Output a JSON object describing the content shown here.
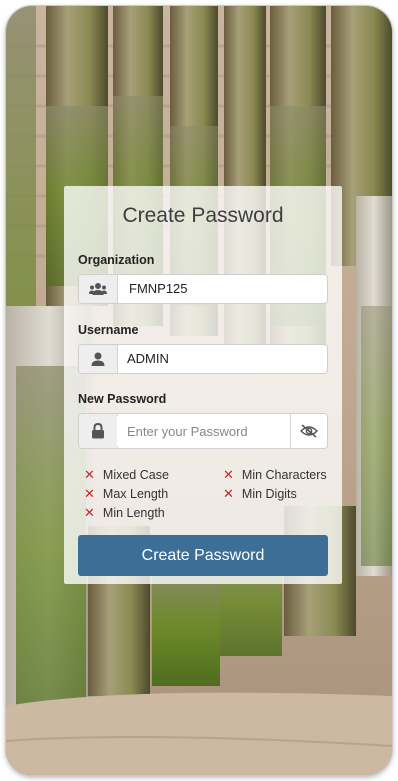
{
  "title": "Create Password",
  "organization": {
    "label": "Organization",
    "value": "FMNP125",
    "icon": "users-icon"
  },
  "username": {
    "label": "Username",
    "value": "ADMIN",
    "icon": "user-icon"
  },
  "new_password": {
    "label": "New Password",
    "placeholder": "Enter your Password",
    "value": "",
    "icon": "lock-icon",
    "toggle_icon": "eye-slash-icon"
  },
  "rules": {
    "mixed_case": "Mixed Case",
    "min_characters": "Min Characters",
    "max_length": "Max Length",
    "min_digits": "Min Digits",
    "min_length": "Min Length",
    "status_icon": "x-icon",
    "status_color": "#c62828"
  },
  "submit_label": "Create Password",
  "colors": {
    "button": "#3d6e96",
    "card": "rgba(255,255,255,0.78)"
  }
}
